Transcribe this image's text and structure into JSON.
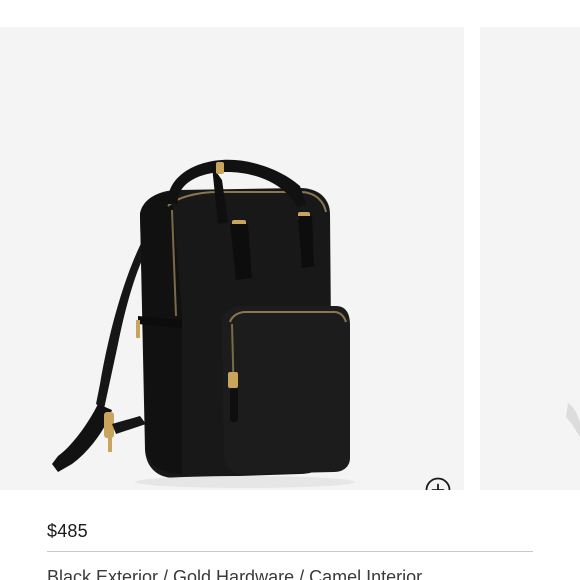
{
  "product": {
    "image_alt": "Black backpack with gold hardware",
    "price": "$485",
    "variant": "Black Exterior / Gold Hardware / Camel Interior"
  },
  "gallery": {
    "zoom_icon": "zoom-in-icon"
  },
  "colors": {
    "background": "#ffffff",
    "image_background": "#f4f4f4",
    "bag": "#141414",
    "hardware": "#c8a45c",
    "divider": "#c9c9c9"
  }
}
